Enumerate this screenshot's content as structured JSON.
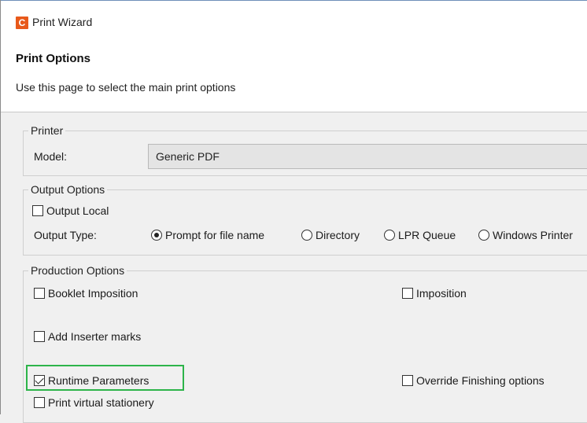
{
  "window": {
    "title": "Print Wizard",
    "app_icon_letter": "C"
  },
  "header": {
    "title": "Print Options",
    "description": "Use this page to select the main print options"
  },
  "printer": {
    "legend": "Printer",
    "model_label": "Model:",
    "model_value": "Generic PDF"
  },
  "output": {
    "legend": "Output Options",
    "output_local_label": "Output Local",
    "output_local_checked": false,
    "type_label": "Output Type:",
    "types": [
      {
        "label": "Prompt for file name",
        "selected": true
      },
      {
        "label": "Directory",
        "selected": false
      },
      {
        "label": "LPR Queue",
        "selected": false
      },
      {
        "label": "Windows Printer",
        "selected": false
      }
    ]
  },
  "production": {
    "legend": "Production Options",
    "booklet_imposition": {
      "label": "Booklet Imposition",
      "checked": false
    },
    "imposition": {
      "label": "Imposition",
      "checked": false
    },
    "add_inserter_marks": {
      "label": "Add Inserter marks",
      "checked": false
    },
    "runtime_parameters": {
      "label": "Runtime Parameters",
      "checked": true
    },
    "override_finishing": {
      "label": "Override Finishing options",
      "checked": false
    },
    "print_virtual_stationery": {
      "label": "Print virtual stationery",
      "checked": false
    }
  },
  "colors": {
    "highlight": "#2db44a",
    "app_icon": "#e8591a"
  }
}
